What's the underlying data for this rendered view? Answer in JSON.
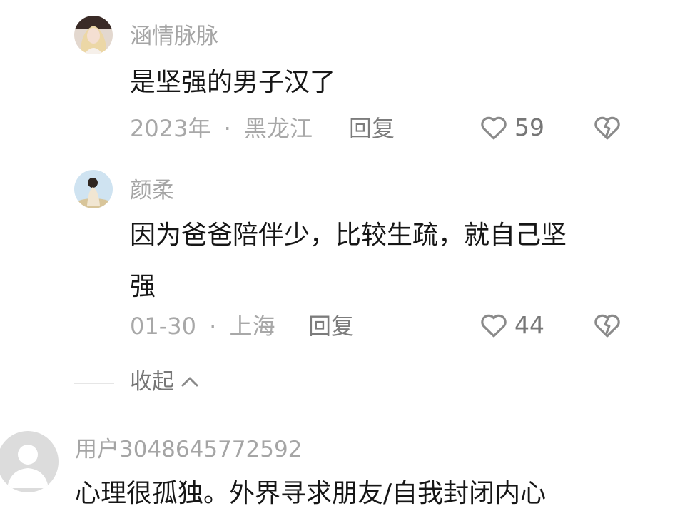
{
  "comments": [
    {
      "username": "涵情脉脉",
      "lines": [
        "是坚强的男子汉了"
      ],
      "time": "2023年",
      "separator": "·",
      "location": "黑龙江",
      "reply_label": "回复",
      "likes": "59",
      "avatar_icon": "user-photo-icon"
    },
    {
      "username": "颜柔",
      "lines": [
        "因为爸爸陪伴少，比较生疏，就自己坚",
        "强"
      ],
      "time": "01-30",
      "separator": "·",
      "location": "上海",
      "reply_label": "回复",
      "likes": "44",
      "avatar_icon": "user-photo-icon"
    },
    {
      "username": "用户3048645772592",
      "lines": [
        "心理很孤独。外界寻求朋友/自我封闭内心"
      ],
      "avatar_icon": "default-user-icon"
    }
  ],
  "collapse": {
    "label": "收起",
    "icon": "chevron-up-icon"
  },
  "icons": {
    "like": "heart-outline-icon",
    "dislike": "broken-heart-icon"
  },
  "colors": {
    "username": "#a5a5a5",
    "content": "#161616",
    "meta": "#a8a8a8",
    "action": "#777777",
    "icon": "#8a8a8a",
    "divider": "#e6e6e6"
  }
}
